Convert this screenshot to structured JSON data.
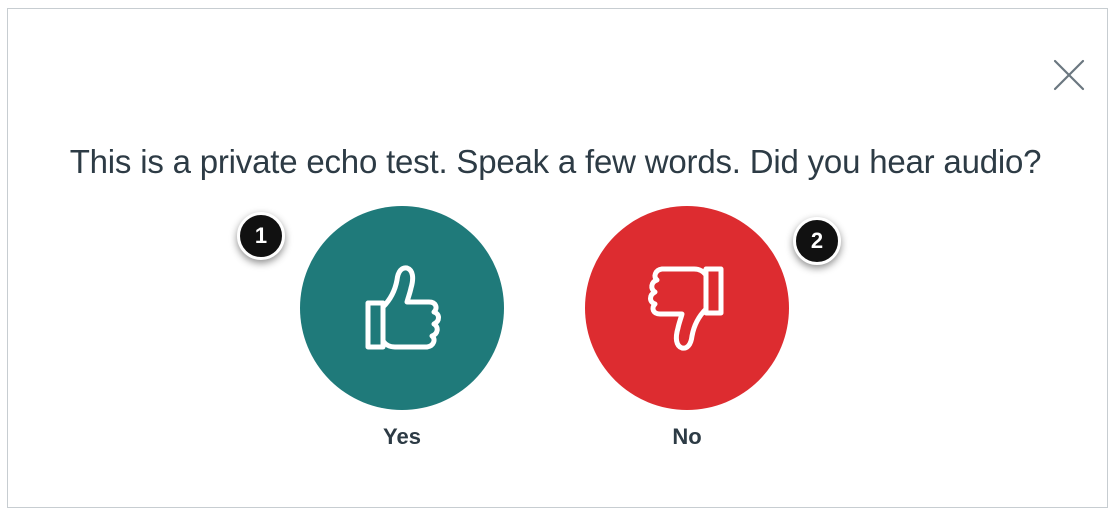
{
  "dialog": {
    "prompt": "This is a private echo test. Speak a few words. Did you hear audio?",
    "close_icon": "close-icon"
  },
  "answers": {
    "yes": {
      "label": "Yes",
      "icon": "thumbs-up-icon",
      "color": "#1f7a7a"
    },
    "no": {
      "label": "No",
      "icon": "thumbs-down-icon",
      "color": "#dd2c30"
    }
  },
  "callouts": {
    "one": "1",
    "two": "2"
  },
  "colors": {
    "text": "#2d3b45",
    "border": "#c7cdd1",
    "callout": "#111111"
  }
}
